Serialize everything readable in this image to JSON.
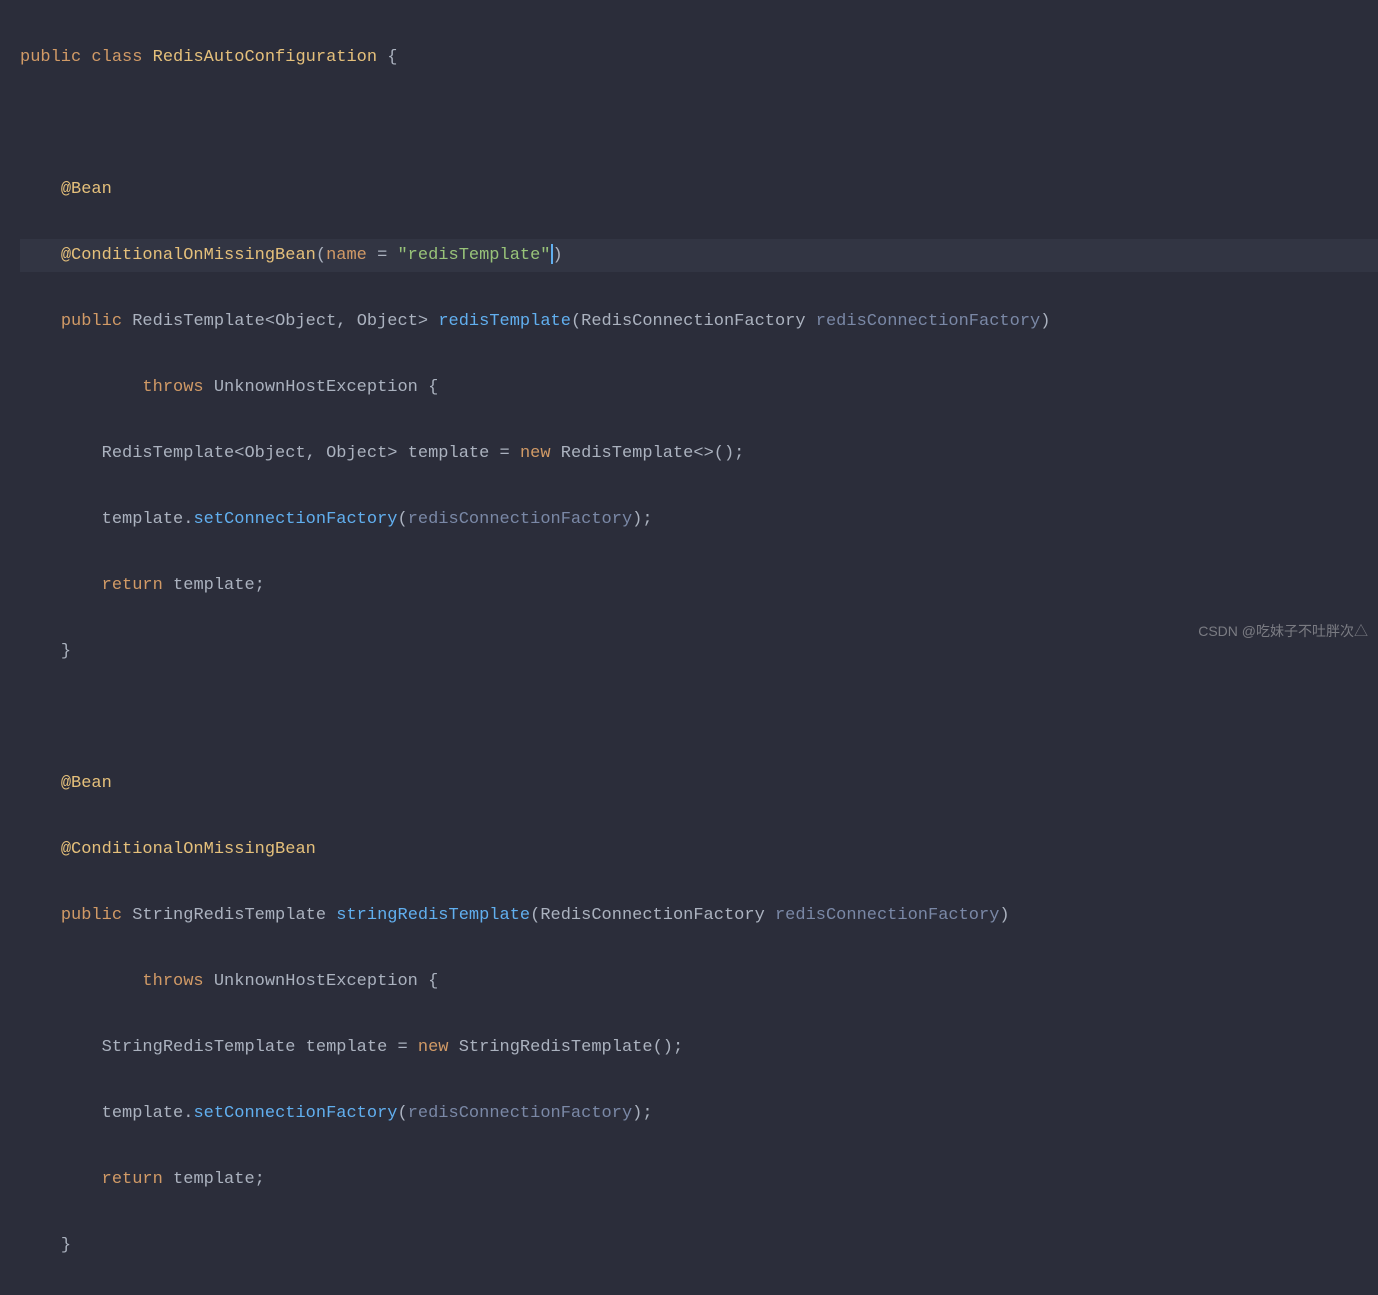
{
  "code": {
    "line1": {
      "public": "public",
      "class": "class",
      "className": "RedisAutoConfiguration",
      "brace": "{"
    },
    "line2": "",
    "line3": {
      "anno": "@Bean"
    },
    "line4": {
      "anno": "@ConditionalOnMissingBean",
      "lparen": "(",
      "paramName": "name",
      "eq": " = ",
      "value": "\"redisTemplate\"",
      "rparen": ")"
    },
    "line5": {
      "public": "public",
      "returnType": "RedisTemplate",
      "lt": "<",
      "obj1": "Object",
      "comma": ", ",
      "obj2": "Object",
      "gt": ">",
      "methodName": "redisTemplate",
      "lparen": "(",
      "paramType": "RedisConnectionFactory",
      "paramName": "redisConnectionFactory",
      "rparen": ")"
    },
    "line6": {
      "throws": "throws",
      "exception": "UnknownHostException",
      "brace": "{"
    },
    "line7": {
      "type": "RedisTemplate",
      "lt": "<",
      "obj1": "Object",
      "comma": ", ",
      "obj2": "Object",
      "gt": ">",
      "var": "template",
      "eq": " = ",
      "new": "new",
      "ctor": "RedisTemplate",
      "diamond": "<>",
      "parens": "();"
    },
    "line8": {
      "var": "template",
      "dot": ".",
      "method": "setConnectionFactory",
      "lparen": "(",
      "arg": "redisConnectionFactory",
      "rparen": ");"
    },
    "line9": {
      "return": "return",
      "var": "template",
      "semi": ";"
    },
    "line10": {
      "brace": "}"
    },
    "line11": "",
    "line12": {
      "anno": "@Bean"
    },
    "line13": {
      "anno": "@ConditionalOnMissingBean"
    },
    "line14": {
      "public": "public",
      "returnType": "StringRedisTemplate",
      "methodName": "stringRedisTemplate",
      "lparen": "(",
      "paramType": "RedisConnectionFactory",
      "paramName": "redisConnectionFactory",
      "rparen": ")"
    },
    "line15": {
      "throws": "throws",
      "exception": "UnknownHostException",
      "brace": "{"
    },
    "line16": {
      "type": "StringRedisTemplate",
      "var": "template",
      "eq": " = ",
      "new": "new",
      "ctor": "StringRedisTemplate",
      "parens": "();"
    },
    "line17": {
      "var": "template",
      "dot": ".",
      "method": "setConnectionFactory",
      "lparen": "(",
      "arg": "redisConnectionFactory",
      "rparen": ");"
    },
    "line18": {
      "return": "return",
      "var": "template",
      "semi": ";"
    },
    "line19": {
      "brace": "}"
    }
  },
  "watermark": "CSDN @吃妹子不吐胖次△"
}
